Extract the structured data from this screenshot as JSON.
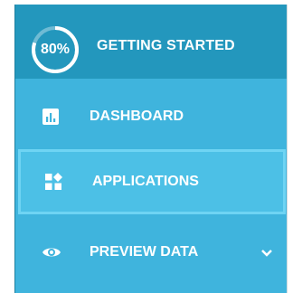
{
  "header": {
    "progress_label": "80%",
    "progress_value": 0.8,
    "title": "GETTING STARTED"
  },
  "menu": {
    "items": [
      {
        "label": "DASHBOARD",
        "icon": "bar-chart-icon"
      },
      {
        "label": "APPLICATIONS",
        "icon": "apps-grid-icon",
        "selected": true
      },
      {
        "label": "PREVIEW DATA",
        "icon": "eye-icon",
        "expandable": true
      }
    ]
  },
  "colors": {
    "sidebar": "#3fb4dd",
    "header": "#2397bd",
    "selected": "#4cc0e6",
    "selected_border": "#6fd4f3",
    "text": "#ffffff"
  }
}
